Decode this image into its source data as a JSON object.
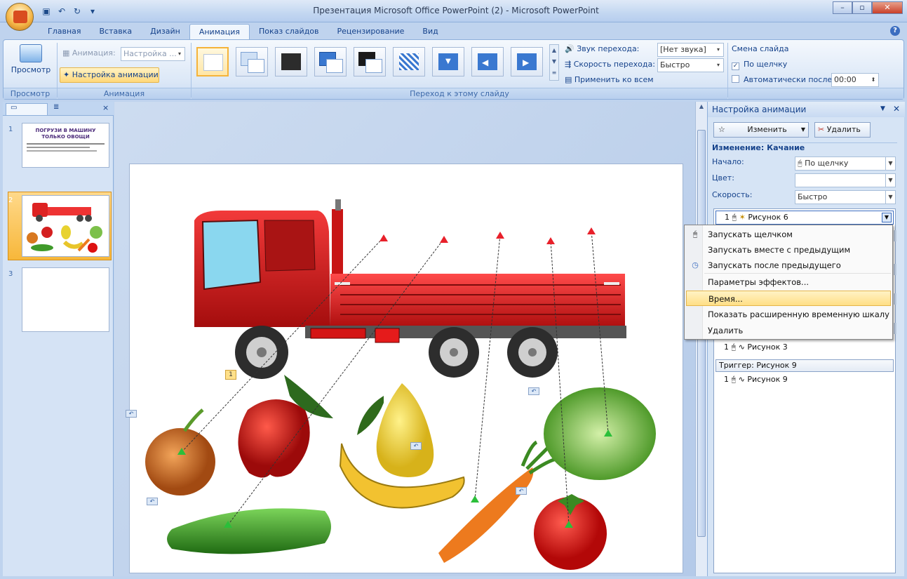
{
  "window": {
    "title": "Презентация Microsoft Office PowerPoint (2) - Microsoft PowerPoint"
  },
  "ribbon_tabs": [
    "Главная",
    "Вставка",
    "Дизайн",
    "Анимация",
    "Показ слайдов",
    "Рецензирование",
    "Вид"
  ],
  "active_tab_index": 3,
  "ribbon": {
    "preview": {
      "label": "Просмотр",
      "group": "Просмотр"
    },
    "animation": {
      "anim_label": "Анимация:",
      "anim_value": "Настройка ...",
      "custom_label": "Настройка анимации",
      "group": "Анимация"
    },
    "transition": {
      "sound_label": "Звук перехода:",
      "sound_value": "[Нет звука]",
      "speed_label": "Скорость перехода:",
      "speed_value": "Быстро",
      "apply_all": "Применить ко всем",
      "group": "Переход к этому слайду"
    },
    "advance": {
      "title": "Смена слайда",
      "on_click": "По щелчку",
      "on_click_checked": true,
      "auto_label": "Автоматически после:",
      "auto_value": "00:00",
      "auto_checked": false
    }
  },
  "slides": [
    {
      "num": "1",
      "title": "ПОГРУЗИ В МАШИНУ ТОЛЬКО ОВОЩИ",
      "selected": false
    },
    {
      "num": "2",
      "selected": true
    },
    {
      "num": "3",
      "selected": false
    }
  ],
  "slide_badge": "1",
  "task_pane": {
    "title": "Настройка анимации",
    "change_btn": "Изменить",
    "delete_btn": "Удалить",
    "section": "Изменение: Качание",
    "start_label": "Начало:",
    "start_value": "По щелчку",
    "color_label": "Цвет:",
    "color_value": "",
    "speed_label": "Скорость:",
    "speed_value": "Быстро",
    "items": [
      {
        "num": "1",
        "name": "Рисунок 6",
        "selected": true
      },
      {
        "num": "1",
        "name": "Рисунок 3",
        "selected": false
      }
    ],
    "trigger": "Триггер: Рисунок 9",
    "trigger_item": {
      "num": "1",
      "name": "Рисунок 9"
    }
  },
  "context_menu": [
    {
      "label": "Запускать щелчком",
      "icon": "mouse-click-icon",
      "highlighted": false
    },
    {
      "label": "Запускать вместе с предыдущим",
      "icon": "",
      "highlighted": false
    },
    {
      "label": "Запускать после предыдущего",
      "icon": "clock-icon",
      "highlighted": false
    },
    {
      "label": "Параметры эффектов...",
      "icon": "",
      "highlighted": false
    },
    {
      "label": "Время...",
      "icon": "",
      "highlighted": true
    },
    {
      "label": "Показать расширенную временную шкалу",
      "icon": "",
      "highlighted": false
    },
    {
      "label": "Удалить",
      "icon": "",
      "highlighted": false
    }
  ]
}
